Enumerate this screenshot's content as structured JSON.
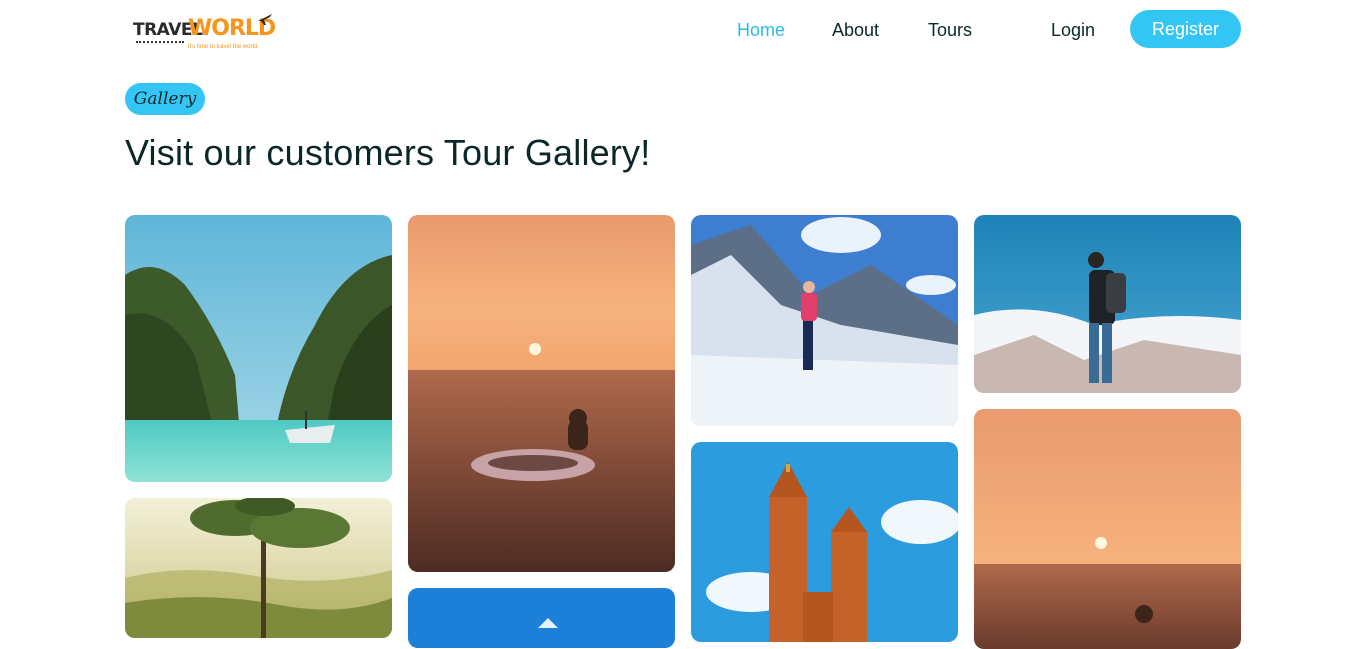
{
  "header": {
    "logo": {
      "brand_part1": "TRAVEL",
      "brand_part2": "WORLD",
      "tagline": "it's time to travel the world",
      "icon": "airplane-icon"
    },
    "nav": [
      {
        "label": "Home",
        "active": true
      },
      {
        "label": "About",
        "active": false
      },
      {
        "label": "Tours",
        "active": false
      }
    ],
    "login_label": "Login",
    "register_label": "Register"
  },
  "section": {
    "badge_label": "Gallery",
    "title": "Visit our customers Tour Gallery!"
  },
  "colors": {
    "accent": "#33c6f4",
    "nav_active": "#2ebbe8",
    "logo_orange": "#f7941d",
    "heading": "#0b2727"
  },
  "gallery": [
    {
      "scene": "tropical-lagoon-boat"
    },
    {
      "scene": "misty-pine-valley"
    },
    {
      "scene": "sunset-sea-swimmer"
    },
    {
      "scene": "blue-sky"
    },
    {
      "scene": "climber-on-glacier"
    },
    {
      "scene": "gothic-church-towers"
    },
    {
      "scene": "hiker-on-summit"
    },
    {
      "scene": "sunset-sea-swimmer"
    }
  ]
}
